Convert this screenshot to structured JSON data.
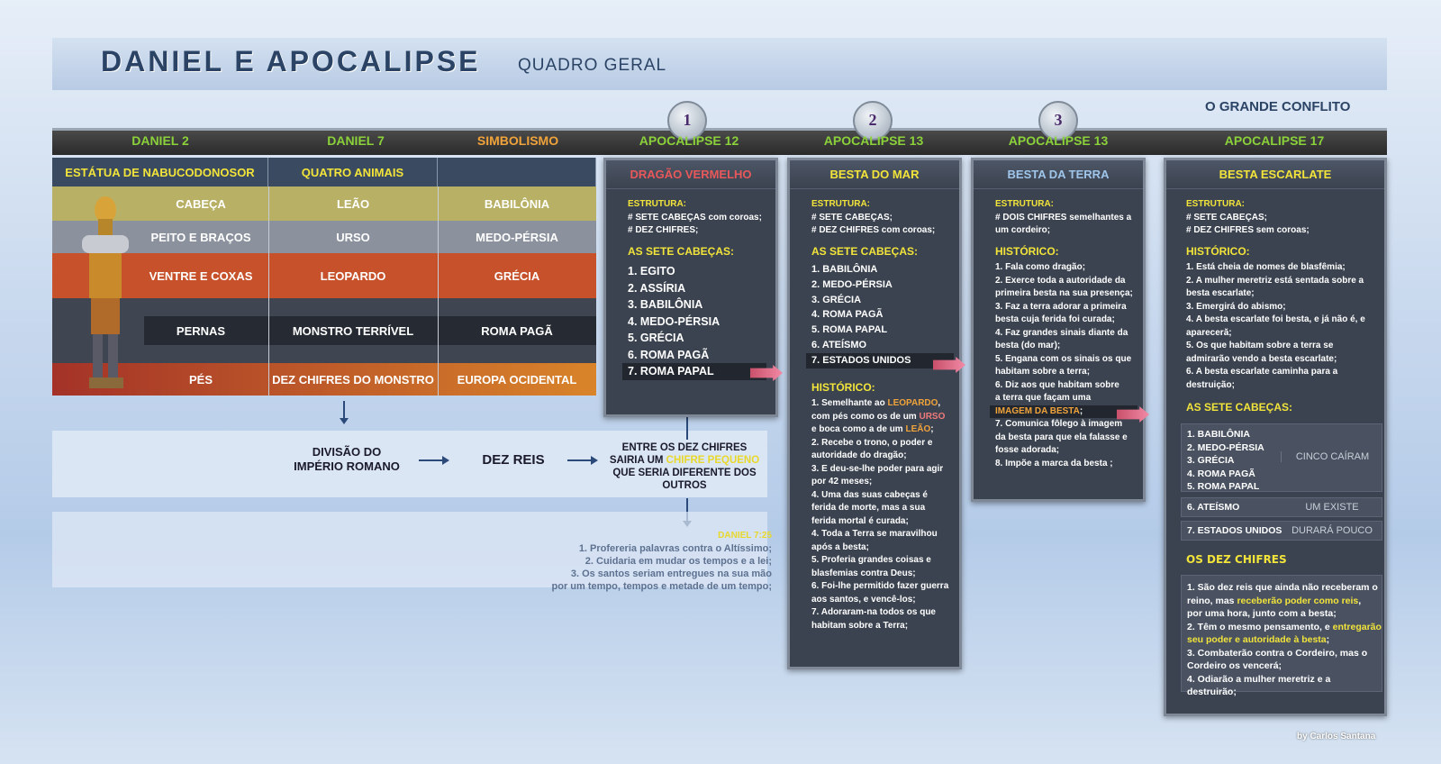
{
  "title": "DANIEL E APOCALIPSE",
  "subtitle": "QUADRO GERAL",
  "conflict": "O GRANDE CONFLITO",
  "columns": [
    "DANIEL 2",
    "DANIEL 7",
    "SIMBOLISMO",
    "APOCALIPSE 12",
    "APOCALIPSE 13",
    "APOCALIPSE 13",
    "APOCALIPSE 17"
  ],
  "badges": [
    "1",
    "2",
    "3"
  ],
  "grid": {
    "heads": [
      "ESTÁTUA DE NABUCODONOSOR",
      "QUATRO ANIMAIS",
      ""
    ],
    "rows": [
      [
        "CABEÇA",
        "LEÃO",
        "BABILÔNIA"
      ],
      [
        "PEITO E BRAÇOS",
        "URSO",
        "MEDO-PÉRSIA"
      ],
      [
        "VENTRE E COXAS",
        "LEOPARDO",
        "GRÉCIA"
      ],
      [
        "PERNAS",
        "MONSTRO TERRÍVEL",
        "ROMA PAGÃ"
      ],
      [
        "PÉS",
        "DEZ CHIFRES DO MONSTRO",
        "EUROPA OCIDENTAL"
      ]
    ]
  },
  "ap12": {
    "head": "DRAGÃO VERMELHO",
    "estrutura": "ESTRUTURA:",
    "e1": "# SETE CABEÇAS com coroas;",
    "e2": "# DEZ CHIFRES;",
    "sete": "AS SETE CABEÇAS:",
    "items": [
      "1. EGITO",
      "2. ASSÍRIA",
      "3. BABILÔNIA",
      "4. MEDO-PÉRSIA",
      "5. GRÉCIA",
      "6. ROMA PAGÃ",
      "7. ROMA PAPAL"
    ]
  },
  "ap13a": {
    "head": "BESTA DO MAR",
    "estrutura": "ESTRUTURA:",
    "e1": "# SETE CABEÇAS;",
    "e2": "# DEZ CHIFRES com coroas;",
    "sete": "AS SETE CABEÇAS:",
    "items": [
      "1. BABILÔNIA",
      "2. MEDO-PÉRSIA",
      "3. GRÉCIA",
      "4. ROMA PAGÃ",
      "5. ROMA PAPAL",
      "6. ATEÍSMO",
      "7. ESTADOS UNIDOS"
    ],
    "historico": "HISTÓRICO:",
    "h1a": "1. Semelhante ao ",
    "h1b": "LEOPARDO",
    "h1c": "com pés como os de um ",
    "h1d": "URSO",
    "h1e": "e boca como a de um ",
    "h1f": "LEÃO",
    "rest": [
      "2. Recebe o trono, o poder e",
      "autoridade do dragão;",
      "3. E deu-se-lhe poder para agir",
      "por 42 meses;",
      "4. Uma das suas cabeças é",
      "ferida de morte, mas a sua",
      "ferida mortal é curada;",
      "4. Toda a Terra se maravilhou",
      "após a besta;",
      "5. Proferia grandes coisas e",
      "blasfemias contra Deus;",
      "6. Foi-lhe permitido fazer guerra",
      "aos santos, e vencê-los;",
      "7. Adoraram-na todos os que",
      "habitam sobre a Terra;"
    ]
  },
  "ap13b": {
    "head": "BESTA DA TERRA",
    "estrutura": "ESTRUTURA:",
    "e1": "# DOIS CHIFRES semelhantes a",
    "e2": "um cordeiro;",
    "historico": "HISTÓRICO:",
    "items": [
      "1. Fala como dragão;",
      "2. Exerce toda a autoridade da",
      "primeira besta na sua presença;",
      "3. Faz a terra adorar a primeira",
      "besta cuja ferida foi curada;",
      "4. Faz grandes sinais diante da",
      "besta (do mar);",
      "5. Engana com os sinais os que",
      "habitam sobre a terra;",
      "6. Diz aos que habitam sobre",
      "a terra que façam uma"
    ],
    "imagem": "IMAGEM DA BESTA",
    "items2": [
      "7. Comunica fôlego à imagem",
      "da besta para que ela falasse e",
      "fosse adorada;",
      "8. Impõe a marca da besta ;"
    ]
  },
  "ap17": {
    "head": "BESTA ESCARLATE",
    "estrutura": "ESTRUTURA:",
    "e1": "# SETE CABEÇAS;",
    "e2": "# DEZ CHIFRES sem coroas;",
    "historico": "HISTÓRICO:",
    "items": [
      "1. Está cheia de nomes de blasfêmia;",
      "2. A mulher meretriz está sentada sobre a",
      "besta escarlate;",
      "3. Emergirá do abismo;",
      "4. A besta escarlate foi besta, e já não é, e",
      "apareceră;",
      "5. Os que habitam sobre a terra se",
      "admirarão vendo a besta escarlate;",
      "6. A besta escarlate caminha para a",
      "destruição;"
    ],
    "sete": "AS SETE CABEÇAS:",
    "five": [
      "1. BABILÔNIA",
      "2. MEDO-PÉRSIA",
      "3. GRÉCIA",
      "4. ROMA PAGÃ",
      "5. ROMA PAPAL"
    ],
    "cinco": "CINCO CAÍRAM",
    "six": "6. ATEÍSMO",
    "um": "UM EXISTE",
    "seven": "7. ESTADOS UNIDOS",
    "durara": "DURARÁ POUCO",
    "dez": "OS DEZ CHIFRES",
    "d1": "1. São dez reis que ainda não receberam o",
    "d2a": "reino, mas ",
    "d2b": "receberão poder como reis",
    "d3": "por uma hora, junto com a besta;",
    "d4a": "2. Têm o mesmo pensamento, e ",
    "d4b": "entregarão",
    "d5": "seu poder e autoridade à besta",
    "d6": "3. Combaterão contra o Cordeiro, mas o",
    "d7": "Cordeiro os vencerá;",
    "d8": "4. Odiarão a mulher meretriz e a destruirão;"
  },
  "flow": {
    "divisao1": "DIVISÃO DO",
    "divisao2": "IMPÉRIO ROMANO",
    "dez": "DEZ REIS",
    "entre1": "ENTRE OS DEZ CHIFRES",
    "entre2a": "SAIRIA UM ",
    "entre2b": "CHIFRE PEQUENO",
    "entre3": "QUE SERIA DIFERENTE DOS",
    "entre4": "OUTROS"
  },
  "d725": {
    "ref": "DANIEL 7:25",
    "lines": [
      "1. Profereria palavras contra o Altíssimo;",
      "2. Cuidaria em mudar os tempos e a lei;",
      "3. Os santos seriam entregues na sua mão",
      "por um tempo, tempos e metade de um tempo;"
    ]
  },
  "credit": "by Carlos Santana"
}
